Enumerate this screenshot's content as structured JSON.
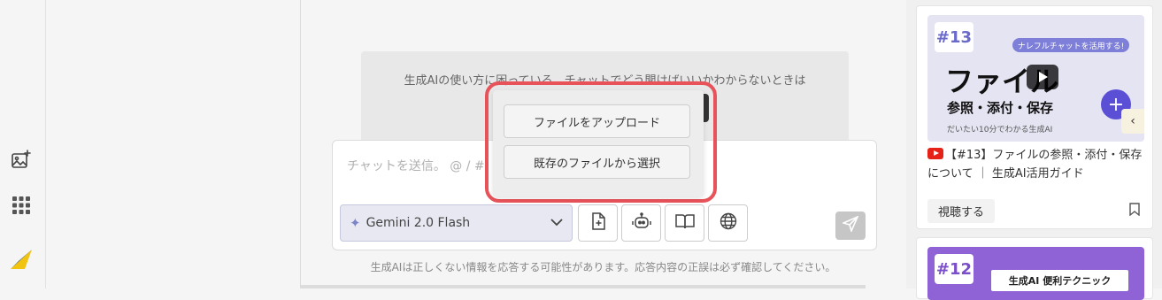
{
  "composer": {
    "placeholder": "チャットを送信。 @ / #",
    "model_label": "Gemini 2.0 Flash",
    "disclaimer": "生成AIは正しくない情報を応答する可能性があります。応答内容の正誤は必ず確認してください。"
  },
  "hint": {
    "text": "生成AIの使い方に困っている、チャットでどう聞けばいいかわからないときは"
  },
  "upload_menu": {
    "items": [
      {
        "label": "ファイルをアップロード"
      },
      {
        "label": "既存のファイルから選択"
      }
    ]
  },
  "video_card": {
    "thumbnail": {
      "badge": "#13",
      "banner": "ナレフルチャットを活用する!",
      "headline": "ファイル",
      "sub": "参照・添付・保存",
      "note": "だいたい10分でわかる生成AI"
    },
    "title": "【#13】ファイルの参照・添付・保存について ｜ 生成AI活用ガイド",
    "watch_label": "視聴する"
  },
  "next_card": {
    "badge": "#12",
    "label": "生成AI 便利テクニック"
  },
  "icons": {
    "rail": [
      "image-sparkle-icon",
      "apps-grid-icon",
      "logo-icon"
    ],
    "tools": [
      "attach-file-icon",
      "robot-icon",
      "book-icon",
      "globe-icon"
    ],
    "send": "send-icon"
  },
  "colors": {
    "highlight": "#e8535a",
    "model_select_bg": "#e7e8f2",
    "youtube": "#e62117"
  }
}
